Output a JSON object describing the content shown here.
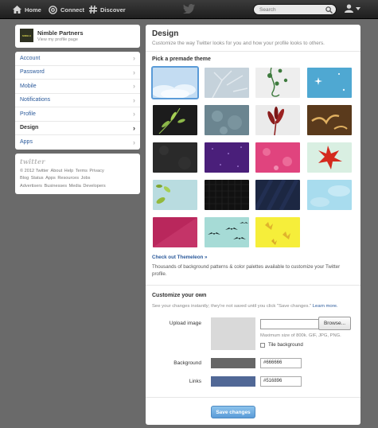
{
  "topbar": {
    "home_label": "Home",
    "connect_label": "Connect",
    "discover_label": "Discover",
    "search_placeholder": "Search",
    "icons": [
      "home-icon",
      "at-icon",
      "hash-icon",
      "twitter-bird-icon",
      "search-icon",
      "user-icon",
      "caret-down-icon"
    ]
  },
  "profile": {
    "name": "Nimble Partners",
    "link_text": "View my profile page",
    "avatar_text": "NIMBLE"
  },
  "settings_menu": {
    "items": [
      {
        "label": "Account",
        "active": false
      },
      {
        "label": "Password",
        "active": false
      },
      {
        "label": "Mobile",
        "active": false
      },
      {
        "label": "Notifications",
        "active": false
      },
      {
        "label": "Profile",
        "active": false
      },
      {
        "label": "Design",
        "active": true
      },
      {
        "label": "Apps",
        "active": false
      }
    ]
  },
  "footer": {
    "logo": "twitter",
    "links": [
      "© 2012 Twitter",
      "About",
      "Help",
      "Terms",
      "Privacy",
      "Blog",
      "Status",
      "Apps",
      "Resources",
      "Jobs",
      "Advertisers",
      "Businesses",
      "Media",
      "Developers"
    ]
  },
  "design": {
    "title": "Design",
    "subtitle": "Customize the way Twitter looks for you and how your profile looks to others.",
    "premade_title": "Pick a premade theme",
    "themes": [
      {
        "name": "clouds",
        "color": "#c3dcf2",
        "selected": true
      },
      {
        "name": "tree-branches",
        "color": "#c5d2db"
      },
      {
        "name": "vines",
        "color": "#eeeeee"
      },
      {
        "name": "sparkle-blue",
        "color": "#4fa8d2"
      },
      {
        "name": "green-leaves-dark",
        "color": "#1c1c1c"
      },
      {
        "name": "floral-gray",
        "color": "#6b8590"
      },
      {
        "name": "red-plant",
        "color": "#ebebeb"
      },
      {
        "name": "brown-birds",
        "color": "#5a3a1c"
      },
      {
        "name": "dark-texture",
        "color": "#2a2a2a"
      },
      {
        "name": "purple-stars",
        "color": "#4a1f7a"
      },
      {
        "name": "pink-flowers",
        "color": "#e0447e"
      },
      {
        "name": "red-maple",
        "color": "#d9efe2"
      },
      {
        "name": "leaves-teal",
        "color": "#b9dce0"
      },
      {
        "name": "black-hex",
        "color": "#111111"
      },
      {
        "name": "navy-stripes",
        "color": "#1c2742"
      },
      {
        "name": "light-blue-clouds",
        "color": "#a8dcee"
      },
      {
        "name": "magenta-diagonal",
        "color": "#b9275c"
      },
      {
        "name": "flying-birds",
        "color": "#a6dbd6"
      },
      {
        "name": "yellow-butterflies",
        "color": "#f6ee3a"
      }
    ],
    "themeleon_link": "Check out Themeleon »",
    "themeleon_desc": "Thousands of background patterns & color palettes available to customize your Twitter profile.",
    "custom_title": "Customize your own",
    "custom_note": "See your changes instantly; they're not saved until you click \"Save changes.\"",
    "learn_more": "Learn more.",
    "upload_label": "Upload image",
    "browse_label": "Browse...",
    "size_note": "Maximum size of 800k. GIF, JPG, PNG.",
    "tile_label": "Tile background",
    "tile_checked": false,
    "background_label": "Background",
    "background_color": "#666666",
    "links_label": "Links",
    "links_color": "#516896",
    "save_label": "Save changes"
  }
}
